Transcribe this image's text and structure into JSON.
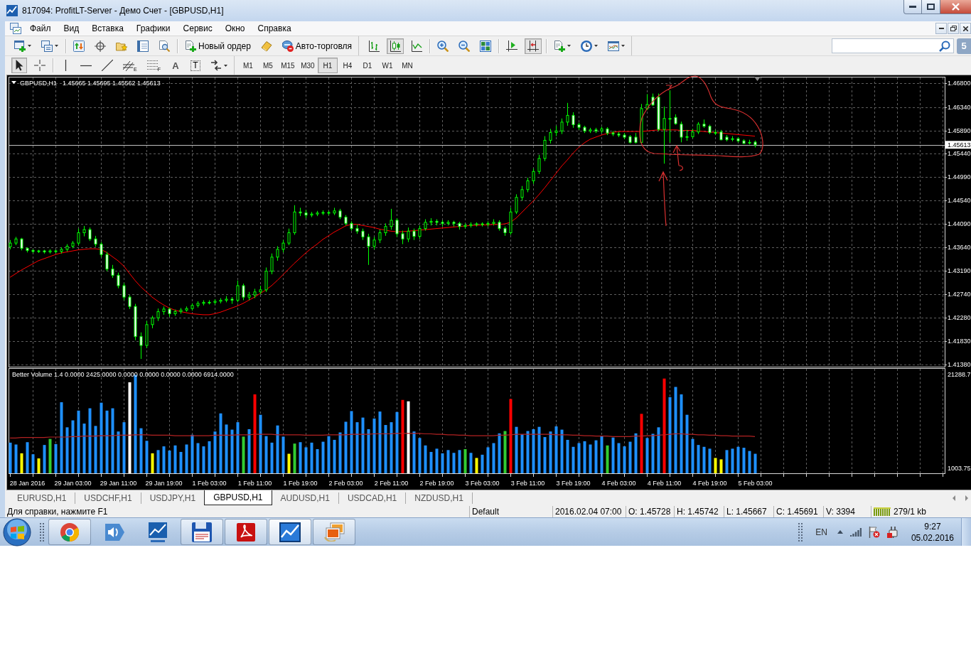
{
  "window": {
    "title": "817094: ProfitLT-Server - Демо Счет - [GBPUSD,H1]"
  },
  "menu": [
    "Файл",
    "Вид",
    "Вставка",
    "Графики",
    "Сервис",
    "Окно",
    "Справка"
  ],
  "toolbar": {
    "new_order": "Новый ордер",
    "auto_trading": "Авто-торговля",
    "chart_types": [
      {
        "kind": "bars",
        "selected": false
      },
      {
        "kind": "candles",
        "selected": true
      },
      {
        "kind": "line",
        "selected": false
      }
    ],
    "auto_scroll": {
      "on": false
    },
    "chart_shift": {
      "on": true
    },
    "notifications": "5"
  },
  "drawing_tools": [
    {
      "kind": "cursor",
      "selected": true
    },
    {
      "kind": "crosshair",
      "selected": false
    },
    {
      "kind": "vline",
      "selected": false
    },
    {
      "kind": "hline",
      "selected": false
    },
    {
      "kind": "trendline",
      "selected": false
    },
    {
      "kind": "channel",
      "label": "E",
      "selected": false
    },
    {
      "kind": "fibo",
      "label": "F",
      "selected": false
    },
    {
      "kind": "text",
      "label": "A",
      "selected": false
    },
    {
      "kind": "textlabel",
      "label": "T",
      "selected": false
    },
    {
      "kind": "arrows",
      "selected": false
    }
  ],
  "timeframes": [
    {
      "label": "M1",
      "selected": false
    },
    {
      "label": "M5",
      "selected": false
    },
    {
      "label": "M15",
      "selected": false
    },
    {
      "label": "M30",
      "selected": false
    },
    {
      "label": "H1",
      "selected": true
    },
    {
      "label": "H4",
      "selected": false
    },
    {
      "label": "D1",
      "selected": false
    },
    {
      "label": "W1",
      "selected": false
    },
    {
      "label": "MN",
      "selected": false
    }
  ],
  "chart": {
    "chart_data": [
      {
        "type": "candlestick",
        "title": "GBPUSD,H1",
        "subtitle": "1.45665 1.45695 1.45562 1.45613",
        "tick_labels": "y",
        "grid": true,
        "ylim": [
          1.4134,
          1.4691
        ],
        "yticks": [
          {
            "value": 1.468,
            "label": "1.46800"
          },
          {
            "value": 1.4634,
            "label": "1.46340"
          },
          {
            "value": 1.4589,
            "label": "1.45890"
          },
          {
            "value": 1.4544,
            "label": "1.45440"
          },
          {
            "value": 1.4499,
            "label": "1.44990"
          },
          {
            "value": 1.4454,
            "label": "1.44540"
          },
          {
            "value": 1.4409,
            "label": "1.44090"
          },
          {
            "value": 1.4364,
            "label": "1.43640"
          },
          {
            "value": 1.4319,
            "label": "1.43190"
          },
          {
            "value": 1.4274,
            "label": "1.42740"
          },
          {
            "value": 1.4228,
            "label": "1.42280"
          },
          {
            "value": 1.4183,
            "label": "1.41830"
          },
          {
            "value": 1.4138,
            "label": "1.41380"
          }
        ],
        "ref_lines": [
          {
            "axis": "y",
            "value": 1.45613,
            "label": "1.45613",
            "color": "#c0c0c0"
          }
        ],
        "ohlc": [
          [
            1.4365,
            1.4378,
            1.436,
            1.4372
          ],
          [
            1.4372,
            1.4384,
            1.4368,
            1.438
          ],
          [
            1.438,
            1.4382,
            1.4358,
            1.4362
          ],
          [
            1.4362,
            1.4364,
            1.4354,
            1.4358
          ],
          [
            1.4358,
            1.436,
            1.4353,
            1.4356
          ],
          [
            1.4356,
            1.4359,
            1.4353,
            1.4357
          ],
          [
            1.4357,
            1.4359,
            1.4352,
            1.4355
          ],
          [
            1.4355,
            1.436,
            1.4352,
            1.4357
          ],
          [
            1.4357,
            1.4359,
            1.4353,
            1.4356
          ],
          [
            1.4356,
            1.4364,
            1.4352,
            1.436
          ],
          [
            1.436,
            1.437,
            1.4356,
            1.4366
          ],
          [
            1.4366,
            1.4376,
            1.4362,
            1.4372
          ],
          [
            1.4372,
            1.44,
            1.4368,
            1.4392
          ],
          [
            1.4392,
            1.4405,
            1.4385,
            1.4398
          ],
          [
            1.4398,
            1.4402,
            1.4376,
            1.438
          ],
          [
            1.438,
            1.4386,
            1.4365,
            1.437
          ],
          [
            1.437,
            1.4374,
            1.4345,
            1.435
          ],
          [
            1.435,
            1.4355,
            1.4318,
            1.4322
          ],
          [
            1.4322,
            1.433,
            1.4305,
            1.431
          ],
          [
            1.431,
            1.4315,
            1.4285,
            1.429
          ],
          [
            1.429,
            1.4295,
            1.4262,
            1.4268
          ],
          [
            1.4268,
            1.4272,
            1.4245,
            1.425
          ],
          [
            1.425,
            1.4255,
            1.4185,
            1.4192
          ],
          [
            1.4192,
            1.42,
            1.4149,
            1.4175
          ],
          [
            1.4175,
            1.4222,
            1.417,
            1.4215
          ],
          [
            1.4215,
            1.4232,
            1.4208,
            1.4228
          ],
          [
            1.4228,
            1.4246,
            1.4222,
            1.424
          ],
          [
            1.424,
            1.425,
            1.4234,
            1.4245
          ],
          [
            1.4245,
            1.4248,
            1.423,
            1.4236
          ],
          [
            1.4236,
            1.4244,
            1.4232,
            1.424
          ],
          [
            1.424,
            1.4247,
            1.4236,
            1.4243
          ],
          [
            1.4243,
            1.425,
            1.424,
            1.4246
          ],
          [
            1.4246,
            1.4256,
            1.4242,
            1.4252
          ],
          [
            1.4252,
            1.426,
            1.4248,
            1.4256
          ],
          [
            1.4256,
            1.4262,
            1.4252,
            1.4258
          ],
          [
            1.4258,
            1.4262,
            1.4254,
            1.4258
          ],
          [
            1.4258,
            1.4264,
            1.4254,
            1.426
          ],
          [
            1.426,
            1.4266,
            1.4256,
            1.4262
          ],
          [
            1.4262,
            1.427,
            1.4258,
            1.4264
          ],
          [
            1.4264,
            1.4268,
            1.4255,
            1.4262
          ],
          [
            1.4262,
            1.43,
            1.4258,
            1.429
          ],
          [
            1.429,
            1.4294,
            1.4262,
            1.4268
          ],
          [
            1.4268,
            1.4278,
            1.4262,
            1.4272
          ],
          [
            1.4272,
            1.4284,
            1.4266,
            1.4278
          ],
          [
            1.4278,
            1.429,
            1.4274,
            1.4282
          ],
          [
            1.4282,
            1.4325,
            1.4278,
            1.4318
          ],
          [
            1.4318,
            1.4352,
            1.4312,
            1.4345
          ],
          [
            1.4345,
            1.4366,
            1.4338,
            1.436
          ],
          [
            1.436,
            1.4378,
            1.4354,
            1.4372
          ],
          [
            1.4372,
            1.44,
            1.4368,
            1.4392
          ],
          [
            1.4392,
            1.4445,
            1.4388,
            1.4432
          ],
          [
            1.4432,
            1.444,
            1.4424,
            1.443
          ],
          [
            1.443,
            1.4436,
            1.442,
            1.4426
          ],
          [
            1.4426,
            1.4432,
            1.4422,
            1.4428
          ],
          [
            1.4428,
            1.4434,
            1.4424,
            1.443
          ],
          [
            1.443,
            1.4435,
            1.4426,
            1.4431
          ],
          [
            1.4431,
            1.4434,
            1.4426,
            1.443
          ],
          [
            1.443,
            1.444,
            1.4426,
            1.4434
          ],
          [
            1.4434,
            1.4438,
            1.4418,
            1.4422
          ],
          [
            1.4422,
            1.4426,
            1.4406,
            1.441
          ],
          [
            1.441,
            1.4414,
            1.4396,
            1.44
          ],
          [
            1.44,
            1.4408,
            1.439,
            1.4395
          ],
          [
            1.4395,
            1.44,
            1.4378,
            1.4384
          ],
          [
            1.4384,
            1.439,
            1.433,
            1.4366
          ],
          [
            1.4366,
            1.4384,
            1.436,
            1.4378
          ],
          [
            1.4378,
            1.4398,
            1.4372,
            1.4392
          ],
          [
            1.4392,
            1.441,
            1.4386,
            1.4404
          ],
          [
            1.4404,
            1.4438,
            1.4398,
            1.4416
          ],
          [
            1.4416,
            1.442,
            1.4384,
            1.439
          ],
          [
            1.439,
            1.4396,
            1.437,
            1.438
          ],
          [
            1.438,
            1.4402,
            1.4374,
            1.4395
          ],
          [
            1.4395,
            1.44,
            1.4378,
            1.4385
          ],
          [
            1.4385,
            1.4406,
            1.438,
            1.44
          ],
          [
            1.44,
            1.4418,
            1.4396,
            1.4412
          ],
          [
            1.4412,
            1.442,
            1.4406,
            1.4414
          ],
          [
            1.4414,
            1.4418,
            1.4406,
            1.4412
          ],
          [
            1.4412,
            1.4416,
            1.4404,
            1.441
          ],
          [
            1.441,
            1.4416,
            1.4406,
            1.4412
          ],
          [
            1.4412,
            1.4415,
            1.4404,
            1.441
          ],
          [
            1.441,
            1.4413,
            1.4398,
            1.4404
          ],
          [
            1.4404,
            1.441,
            1.44,
            1.4406
          ],
          [
            1.4406,
            1.4412,
            1.4402,
            1.4408
          ],
          [
            1.4408,
            1.4412,
            1.4404,
            1.4409
          ],
          [
            1.4409,
            1.4412,
            1.4404,
            1.4408
          ],
          [
            1.4408,
            1.4414,
            1.4404,
            1.441
          ],
          [
            1.441,
            1.4418,
            1.4406,
            1.4412
          ],
          [
            1.4412,
            1.4416,
            1.4396,
            1.44
          ],
          [
            1.44,
            1.4404,
            1.4386,
            1.4392
          ],
          [
            1.4392,
            1.444,
            1.4388,
            1.4432
          ],
          [
            1.4432,
            1.4466,
            1.4428,
            1.446
          ],
          [
            1.446,
            1.4482,
            1.4454,
            1.4475
          ],
          [
            1.4475,
            1.4498,
            1.447,
            1.4492
          ],
          [
            1.4492,
            1.4516,
            1.4486,
            1.451
          ],
          [
            1.451,
            1.4542,
            1.4505,
            1.4535
          ],
          [
            1.4535,
            1.4578,
            1.453,
            1.457
          ],
          [
            1.457,
            1.4592,
            1.4564,
            1.4585
          ],
          [
            1.4585,
            1.4598,
            1.4578,
            1.4588
          ],
          [
            1.4588,
            1.4612,
            1.4582,
            1.4605
          ],
          [
            1.4605,
            1.4642,
            1.4598,
            1.4618
          ],
          [
            1.4618,
            1.4624,
            1.4594,
            1.46
          ],
          [
            1.46,
            1.4604,
            1.459,
            1.4595
          ],
          [
            1.4595,
            1.4598,
            1.4584,
            1.4588
          ],
          [
            1.4588,
            1.4594,
            1.4584,
            1.459
          ],
          [
            1.459,
            1.4594,
            1.4584,
            1.4588
          ],
          [
            1.4588,
            1.4596,
            1.4584,
            1.4592
          ],
          [
            1.4592,
            1.4595,
            1.458,
            1.4584
          ],
          [
            1.4584,
            1.4588,
            1.4578,
            1.4582
          ],
          [
            1.4582,
            1.4586,
            1.4576,
            1.458
          ],
          [
            1.458,
            1.4584,
            1.4572,
            1.4576
          ],
          [
            1.4577,
            1.458,
            1.4564,
            1.4566
          ],
          [
            1.4576,
            1.4584,
            1.4564,
            1.4566
          ],
          [
            1.4566,
            1.464,
            1.4564,
            1.4631
          ],
          [
            1.4631,
            1.4659,
            1.4628,
            1.4639
          ],
          [
            1.4653,
            1.466,
            1.4636,
            1.4638
          ],
          [
            1.4653,
            1.466,
            1.4588,
            1.4591
          ],
          [
            1.4591,
            1.4635,
            1.4525,
            1.4612
          ],
          [
            1.4612,
            1.4666,
            1.4566,
            1.4612
          ],
          [
            1.4614,
            1.462,
            1.46,
            1.4602
          ],
          [
            1.4601,
            1.4606,
            1.4566,
            1.4576
          ],
          [
            1.4576,
            1.459,
            1.4569,
            1.4577
          ],
          [
            1.4577,
            1.4592,
            1.4574,
            1.4586
          ],
          [
            1.4586,
            1.4605,
            1.4582,
            1.4601
          ],
          [
            1.4601,
            1.461,
            1.4594,
            1.4597
          ],
          [
            1.4597,
            1.46,
            1.4582,
            1.4585
          ],
          [
            1.4585,
            1.459,
            1.458,
            1.4584
          ],
          [
            1.4586,
            1.459,
            1.457,
            1.4571
          ],
          [
            1.4576,
            1.458,
            1.4568,
            1.4571
          ],
          [
            1.4573,
            1.4578,
            1.4568,
            1.4573
          ],
          [
            1.4573,
            1.4576,
            1.4566,
            1.4569
          ],
          [
            1.4569,
            1.4572,
            1.4563,
            1.4564
          ],
          [
            1.4566,
            1.4571,
            1.4562,
            1.4566
          ],
          [
            1.45665,
            1.45695,
            1.45562,
            1.45613
          ]
        ],
        "series": [
          {
            "type": "line",
            "color": "#ff0000",
            "values": [
              1.4306,
              1.4313,
              1.432,
              1.4326,
              1.4332,
              1.4338,
              1.4342,
              1.4346,
              1.435,
              1.4353,
              1.4355,
              1.4357,
              1.4359,
              1.436,
              1.4361,
              1.4361,
              1.436,
              1.4354,
              1.4346,
              1.4338,
              1.4328,
              1.4314,
              1.43,
              1.4288,
              1.4278,
              1.4268,
              1.426,
              1.4253,
              1.4247,
              1.4243,
              1.424,
              1.4238,
              1.4236,
              1.4235,
              1.4234,
              1.4234,
              1.4236,
              1.4239,
              1.4243,
              1.4247,
              1.4251,
              1.4256,
              1.4262,
              1.4268,
              1.4275,
              1.4282,
              1.429,
              1.43,
              1.4311,
              1.4322,
              1.4333,
              1.4343,
              1.4353,
              1.4362,
              1.437,
              1.4379,
              1.4386,
              1.4393,
              1.4399,
              1.4405,
              1.4408,
              1.4408,
              1.4406,
              1.4404,
              1.4402,
              1.4399,
              1.4397,
              1.4395,
              1.4394,
              1.4394,
              1.4395,
              1.4396,
              1.4397,
              1.4398,
              1.4399,
              1.44,
              1.4401,
              1.4402,
              1.4403,
              1.4404,
              1.4405,
              1.4406,
              1.4406,
              1.4407,
              1.4407,
              1.4408,
              1.4408,
              1.4409,
              1.4412,
              1.442,
              1.4431,
              1.4442,
              1.4453,
              1.4465,
              1.4478,
              1.4492,
              1.4506,
              1.452,
              1.4532,
              1.4545,
              1.4556,
              1.4565,
              1.4572,
              1.4576,
              1.458,
              1.4583,
              1.4585,
              1.4587,
              1.4587,
              1.4587,
              1.4587,
              1.4587,
              1.4588,
              1.4589,
              1.459,
              1.459,
              1.459,
              1.459,
              1.4589,
              1.4589,
              1.4589,
              1.4588,
              1.4587,
              1.4586,
              1.4585,
              1.4584,
              1.4583,
              1.4582,
              1.4581,
              1.458,
              1.4579,
              1.4578
            ]
          }
        ]
      },
      {
        "type": "bar",
        "title": "Better Volume 1.4 0.0000 2425.0000 0.0000 0.0000 0.0000 0.0000 6914.0000",
        "grid": true,
        "ylim": [
          0,
          22500
        ],
        "yticks": [
          {
            "value": 21288.7,
            "label": "21288.7"
          },
          {
            "value": 1003.75,
            "label": "1003.75"
          }
        ],
        "categories": [
          null,
          null,
          null,
          "28 Jan 2016",
          null,
          null,
          null,
          null,
          null,
          null,
          null,
          "29 Jan 03:00",
          null,
          null,
          null,
          null,
          null,
          null,
          null,
          "29 Jan 11:00",
          null,
          null,
          null,
          null,
          null,
          null,
          null,
          "29 Jan 19:00",
          null,
          null,
          null,
          null,
          null,
          null,
          null,
          "1 Feb 03:00",
          null,
          null,
          null,
          null,
          null,
          null,
          null,
          "1 Feb 11:00",
          null,
          null,
          null,
          null,
          null,
          null,
          null,
          "1 Feb 19:00",
          null,
          null,
          null,
          null,
          null,
          null,
          null,
          "2 Feb 03:00",
          null,
          null,
          null,
          null,
          null,
          null,
          null,
          "2 Feb 11:00",
          null,
          null,
          null,
          null,
          null,
          null,
          null,
          "2 Feb 19:00",
          null,
          null,
          null,
          null,
          null,
          null,
          null,
          "3 Feb 03:00",
          null,
          null,
          null,
          null,
          null,
          null,
          null,
          "3 Feb 11:00",
          null,
          null,
          null,
          null,
          null,
          null,
          null,
          "3 Feb 19:00",
          null,
          null,
          null,
          null,
          null,
          null,
          null,
          "4 Feb 03:00",
          null,
          null,
          null,
          null,
          null,
          null,
          null,
          "4 Feb 11:00",
          null,
          null,
          null,
          null,
          null,
          null,
          null,
          "4 Feb 19:00",
          null,
          null,
          null,
          null,
          null,
          null,
          null,
          "5 Feb 03:00",
          null,
          null,
          null,
          null,
          null,
          null,
          null,
          null,
          null,
          null,
          null,
          null,
          null,
          null,
          null,
          null,
          null,
          null,
          null,
          null,
          null,
          null,
          null,
          null,
          null,
          null,
          null,
          null,
          null,
          null,
          null,
          null,
          null
        ],
        "series": [
          {
            "type": "bar",
            "colors": [
              "#1e90ff",
              "#1e90ff",
              "#ffff00",
              "#1e90ff",
              "#1e90ff",
              "#ffff00",
              "#1e90ff",
              "#32cd32",
              "#1e90ff",
              "#1e90ff",
              "#1e90ff",
              "#1e90ff",
              "#1e90ff",
              "#1e90ff",
              "#1e90ff",
              "#1e90ff",
              "#1e90ff",
              "#1e90ff",
              "#1e90ff",
              "#1e90ff",
              "#1e90ff",
              "#ffffff",
              "#1e90ff",
              "#1e90ff",
              "#1e90ff",
              "#ffff00",
              "#1e90ff",
              "#1e90ff",
              "#1e90ff",
              "#1e90ff",
              "#1e90ff",
              "#1e90ff",
              "#1e90ff",
              "#1e90ff",
              "#1e90ff",
              "#1e90ff",
              "#1e90ff",
              "#1e90ff",
              "#1e90ff",
              "#1e90ff",
              "#1e90ff",
              "#32cd32",
              "#1e90ff",
              "#ff0000",
              "#1e90ff",
              "#1e90ff",
              "#1e90ff",
              "#1e90ff",
              "#1e90ff",
              "#ffff00",
              "#32cd32",
              "#1e90ff",
              "#1e90ff",
              "#1e90ff",
              "#1e90ff",
              "#1e90ff",
              "#1e90ff",
              "#1e90ff",
              "#1e90ff",
              "#1e90ff",
              "#1e90ff",
              "#1e90ff",
              "#1e90ff",
              "#1e90ff",
              "#1e90ff",
              "#1e90ff",
              "#1e90ff",
              "#1e90ff",
              "#1e90ff",
              "#ff0000",
              "#ffffff",
              "#1e90ff",
              "#1e90ff",
              "#1e90ff",
              "#1e90ff",
              "#1e90ff",
              "#1e90ff",
              "#1e90ff",
              "#1e90ff",
              "#1e90ff",
              "#32cd32",
              "#1e90ff",
              "#ffff00",
              "#1e90ff",
              "#1e90ff",
              "#1e90ff",
              "#1e90ff",
              "#32cd32",
              "#ff0000",
              "#1e90ff",
              "#1e90ff",
              "#1e90ff",
              "#1e90ff",
              "#1e90ff",
              "#1e90ff",
              "#1e90ff",
              "#1e90ff",
              "#1e90ff",
              "#1e90ff",
              "#1e90ff",
              "#1e90ff",
              "#1e90ff",
              "#1e90ff",
              "#1e90ff",
              "#1e90ff",
              "#32cd32",
              "#1e90ff",
              "#1e90ff",
              "#1e90ff",
              "#1e90ff",
              "#1e90ff",
              "#ff0000",
              "#1e90ff",
              "#1e90ff",
              "#1e90ff",
              "#ff0000",
              "#1e90ff",
              "#1e90ff",
              "#1e90ff",
              "#1e90ff",
              "#1e90ff",
              "#1e90ff",
              "#1e90ff",
              "#1e90ff",
              "#ffff00",
              "#ffff00",
              "#1e90ff",
              "#1e90ff",
              "#1e90ff",
              "#1e90ff",
              "#1e90ff",
              "#1e90ff",
              null,
              null,
              null,
              null,
              null,
              null,
              null,
              null,
              null,
              null,
              null,
              null,
              null,
              null,
              null,
              null,
              null,
              null,
              null,
              null,
              null,
              null,
              null,
              null,
              null,
              null,
              null,
              null,
              null,
              null,
              null,
              null,
              null
            ],
            "values": [
              6600,
              6200,
              4300,
              6700,
              4100,
              3200,
              6100,
              7400,
              6300,
              15300,
              9900,
              11400,
              13500,
              10700,
              14000,
              10200,
              15200,
              13500,
              14000,
              9000,
              11000,
              19600,
              21200,
              9700,
              7000,
              4300,
              5000,
              5800,
              4900,
              6000,
              4600,
              6200,
              8300,
              6500,
              5800,
              6900,
              9000,
              12900,
              10500,
              9400,
              11000,
              7900,
              9500,
              17000,
              12600,
              8000,
              6600,
              10300,
              7900,
              4200,
              6400,
              6700,
              5600,
              6600,
              5200,
              6800,
              8000,
              7200,
              8800,
              11100,
              13400,
              11000,
              12000,
              9500,
              11800,
              13300,
              10400,
              11000,
              13200,
              15800,
              15500,
              9000,
              7600,
              6000,
              4600,
              5300,
              4300,
              5000,
              4400,
              5000,
              5200,
              4400,
              3300,
              4000,
              5600,
              6500,
              8600,
              9100,
              16000,
              10000,
              8400,
              9100,
              9500,
              10000,
              7800,
              9000,
              10100,
              9400,
              7200,
              5700,
              6500,
              6900,
              6200,
              7100,
              8000,
              6000,
              7700,
              6500,
              5800,
              6800,
              8600,
              12800,
              7600,
              8500,
              9900,
              20400,
              16400,
              18600,
              17000,
              12600,
              7400,
              6100,
              5700,
              5300,
              3300,
              3000,
              5000,
              5300,
              5700,
              5500,
              4800,
              4200,
              null,
              null,
              null,
              null,
              null,
              null,
              null,
              null,
              null,
              null,
              null,
              null,
              null,
              null,
              null,
              null,
              null,
              null,
              null,
              null,
              null,
              null,
              null,
              null,
              null,
              null,
              null,
              null,
              null,
              null,
              null,
              null,
              null
            ]
          },
          {
            "type": "line",
            "color": "#b22222",
            "values": [
              7600,
              7600,
              7700,
              7700,
              7700,
              7700,
              7700,
              7800,
              7800,
              7800,
              7800,
              7900,
              7900,
              8000,
              8000,
              8000,
              8100,
              8100,
              8100,
              8200,
              8200,
              8200,
              8300,
              8300,
              8300,
              8200,
              8200,
              8200,
              8200,
              8100,
              8100,
              8100,
              8100,
              8100,
              8100,
              8100,
              8200,
              8200,
              8200,
              8200,
              8300,
              8300,
              8300,
              8400,
              8400,
              8400,
              8400,
              8300,
              8300,
              8300,
              8300,
              8300,
              8200,
              8200,
              8200,
              8200,
              8300,
              8300,
              8300,
              8300,
              8400,
              8400,
              8400,
              8400,
              8500,
              8500,
              8500,
              8500,
              8600,
              8600,
              8600,
              8600,
              8600,
              8500,
              8500,
              8400,
              8400,
              8300,
              8300,
              8200,
              8200,
              8100,
              8100,
              8100,
              8100,
              8100,
              8200,
              8200,
              8300,
              8400,
              8400,
              8400,
              8400,
              8400,
              8400,
              8400,
              8300,
              8300,
              8300,
              8200,
              8200,
              8100,
              8100,
              8000,
              8000,
              8000,
              7900,
              7900,
              7900,
              7900,
              8000,
              8000,
              8100,
              8100,
              8200,
              8300,
              8400,
              8500,
              8500,
              8400,
              8400,
              8300,
              8300,
              8200,
              8200,
              8100,
              8100,
              8000,
              8000,
              8000,
              8000,
              7900,
              null,
              null,
              null,
              null,
              null,
              null,
              null,
              null,
              null,
              null,
              null,
              null,
              null,
              null,
              null,
              null,
              null,
              null,
              null,
              null,
              null,
              null,
              null,
              null,
              null,
              null,
              null,
              null,
              null,
              null,
              null,
              null,
              null
            ]
          }
        ]
      }
    ]
  },
  "tabs": [
    {
      "label": "EURUSD,H1",
      "selected": false
    },
    {
      "label": "USDCHF,H1",
      "selected": false
    },
    {
      "label": "USDJPY,H1",
      "selected": false
    },
    {
      "label": "GBPUSD,H1",
      "selected": true
    },
    {
      "label": "AUDUSD,H1",
      "selected": false
    },
    {
      "label": "USDCAD,H1",
      "selected": false
    },
    {
      "label": "NZDUSD,H1",
      "selected": false
    }
  ],
  "status_bar": {
    "help": "Для справки, нажмите F1",
    "profile": "Default",
    "time": "2016.02.04 07:00",
    "open": "O: 1.45728",
    "high": "H: 1.45742",
    "low": "L: 1.45667",
    "close": "C: 1.45691",
    "volume": "V: 3394",
    "traffic": "279/1 kb"
  },
  "taskbar": {
    "apps": [
      {
        "kind": "browser",
        "running": true,
        "selected": false
      },
      {
        "kind": "speaker",
        "running": false,
        "selected": false
      },
      {
        "kind": "profit",
        "running": false,
        "selected": false
      },
      {
        "kind": "floppy",
        "running": true,
        "selected": false
      },
      {
        "kind": "pdf",
        "running": true,
        "selected": false
      },
      {
        "kind": "terminal",
        "running": true,
        "selected": true
      },
      {
        "kind": "photos",
        "running": true,
        "selected": false
      }
    ],
    "language": "EN",
    "time": "9:27",
    "date": "05.02.2016"
  }
}
